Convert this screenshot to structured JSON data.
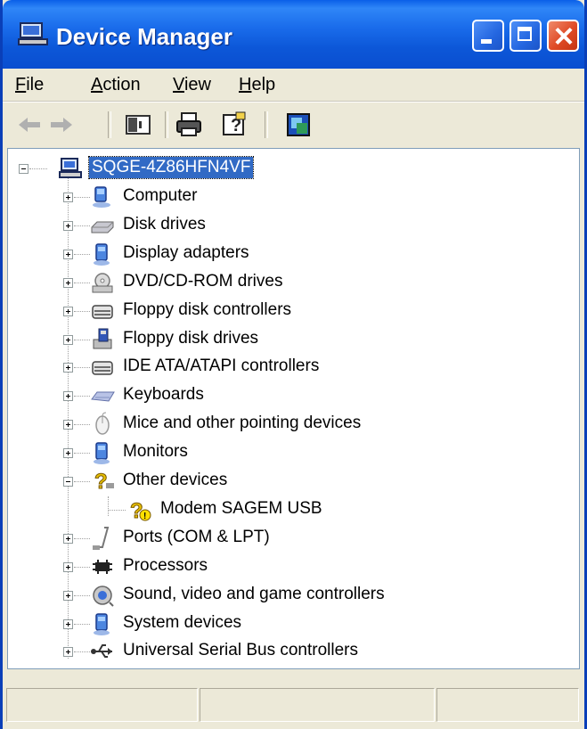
{
  "window": {
    "title": "Device Manager"
  },
  "menubar": {
    "items": [
      {
        "label": "File",
        "mnemonic": "F",
        "rest": "ile"
      },
      {
        "label": "Action",
        "mnemonic": "A",
        "rest": "ction"
      },
      {
        "label": "View",
        "mnemonic": "V",
        "rest": "iew"
      },
      {
        "label": "Help",
        "mnemonic": "H",
        "rest": "elp"
      }
    ]
  },
  "toolbar": {
    "buttons": [
      "back-icon",
      "forward-icon",
      "show-hide-console-tree-icon",
      "print-icon",
      "help-icon",
      "properties-icon"
    ]
  },
  "tree": {
    "root": "SQGE-4Z86HFN4VF",
    "categories": [
      {
        "label": "Computer",
        "icon": "computer-icon"
      },
      {
        "label": "Disk drives",
        "icon": "disk-drive-icon"
      },
      {
        "label": "Display adapters",
        "icon": "display-adapter-icon"
      },
      {
        "label": "DVD/CD-ROM drives",
        "icon": "dvd-drive-icon"
      },
      {
        "label": "Floppy disk controllers",
        "icon": "controller-icon"
      },
      {
        "label": "Floppy disk drives",
        "icon": "floppy-drive-icon"
      },
      {
        "label": "IDE ATA/ATAPI controllers",
        "icon": "controller-icon"
      },
      {
        "label": "Keyboards",
        "icon": "keyboard-icon"
      },
      {
        "label": "Mice and other pointing devices",
        "icon": "mouse-icon"
      },
      {
        "label": "Monitors",
        "icon": "monitor-icon"
      },
      {
        "label": "Other devices",
        "icon": "unknown-device-icon",
        "expanded": true
      },
      {
        "label": "Modem SAGEM USB",
        "icon": "warning-device-icon",
        "child": true
      },
      {
        "label": "Ports (COM & LPT)",
        "icon": "port-icon"
      },
      {
        "label": "Processors",
        "icon": "processor-icon"
      },
      {
        "label": "Sound, video and game controllers",
        "icon": "sound-icon"
      },
      {
        "label": "System devices",
        "icon": "system-device-icon"
      },
      {
        "label": "Universal Serial Bus controllers",
        "icon": "usb-icon"
      }
    ]
  },
  "colors": {
    "titlebar": "#0A5FE8",
    "selection": "#316AC5",
    "window_bg": "#ECE9D8"
  }
}
